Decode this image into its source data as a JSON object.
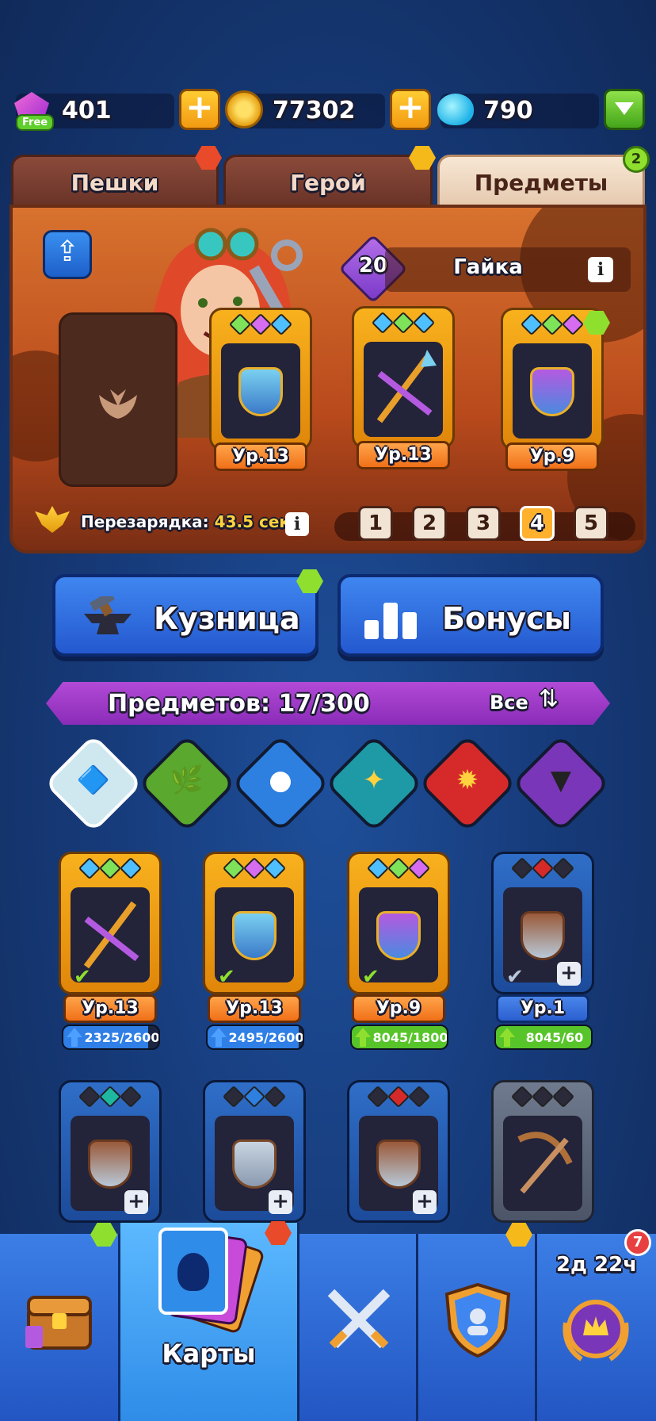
{
  "currencies": {
    "gems": "401",
    "gems_tag": "Free",
    "coins": "77302",
    "drops": "790"
  },
  "tabs": [
    {
      "label": "Пешки"
    },
    {
      "label": "Герой"
    },
    {
      "label": "Предметы",
      "badge": "2"
    }
  ],
  "hero": {
    "level": "20",
    "name": "Гайка",
    "recharge_label": "Перезарядка:",
    "recharge_time": "43.5 сек.",
    "equipped": [
      {
        "level": "Ур.13",
        "gems": [
          "#7fe35a",
          "#d66cf0",
          "#4fc0ff"
        ]
      },
      {
        "level": "Ур.13",
        "gems": [
          "#4fc0ff",
          "#7fe35a",
          "#4fc0ff"
        ]
      },
      {
        "level": "Ур.9",
        "gems": [
          "#4fc0ff",
          "#7fe35a",
          "#d66cf0"
        ]
      }
    ],
    "slots": [
      "1",
      "2",
      "3",
      "4",
      "5"
    ],
    "selected_slot": "4"
  },
  "actions": {
    "forge_label": "Кузница",
    "bonuses_label": "Бонусы"
  },
  "items_header": {
    "count_label": "Предметов: 17/300",
    "sort_label": "Все"
  },
  "filters": [
    {
      "name": "all",
      "color": "#7fd0e0"
    },
    {
      "name": "nature",
      "color": "#5aa82e"
    },
    {
      "name": "magic-ball",
      "color": "#2d7fe0"
    },
    {
      "name": "eagle",
      "color": "#1e9aa6"
    },
    {
      "name": "idea",
      "color": "#d62a2a"
    },
    {
      "name": "bat",
      "color": "#7a36b8"
    }
  ],
  "inventory": [
    {
      "frame": "gold",
      "level": "Ур.13",
      "progress": "2325/2600",
      "fill": 0.89,
      "arrow": "blue",
      "checked": true,
      "gems": [
        "#4fc0ff",
        "#7fe35a",
        "#4fc0ff"
      ]
    },
    {
      "frame": "gold",
      "level": "Ур.13",
      "progress": "2495/2600",
      "fill": 0.96,
      "arrow": "blue",
      "checked": true,
      "gems": [
        "#7fe35a",
        "#d66cf0",
        "#4fc0ff"
      ]
    },
    {
      "frame": "gold",
      "level": "Ур.9",
      "progress": "8045/1800",
      "fill": 1.0,
      "arrow": "green",
      "checked": true,
      "gems": [
        "#4fc0ff",
        "#7fe35a",
        "#d66cf0"
      ]
    },
    {
      "frame": "blue",
      "level": "Ур.1",
      "progress": "8045/60",
      "fill": 1.0,
      "arrow": "green",
      "checked": false,
      "gems": [
        "#d62a2a"
      ]
    },
    {
      "frame": "blue",
      "gems": [
        "#1eb8a0"
      ]
    },
    {
      "frame": "blue",
      "gems": [
        "#2d7fe0"
      ]
    },
    {
      "frame": "blue",
      "gems": [
        "#d62a2a"
      ]
    },
    {
      "frame": "gray",
      "gems": []
    }
  ],
  "bottom_nav": {
    "cards_label": "Карты",
    "timer": "2д 22ч",
    "timer_badge": "7"
  }
}
